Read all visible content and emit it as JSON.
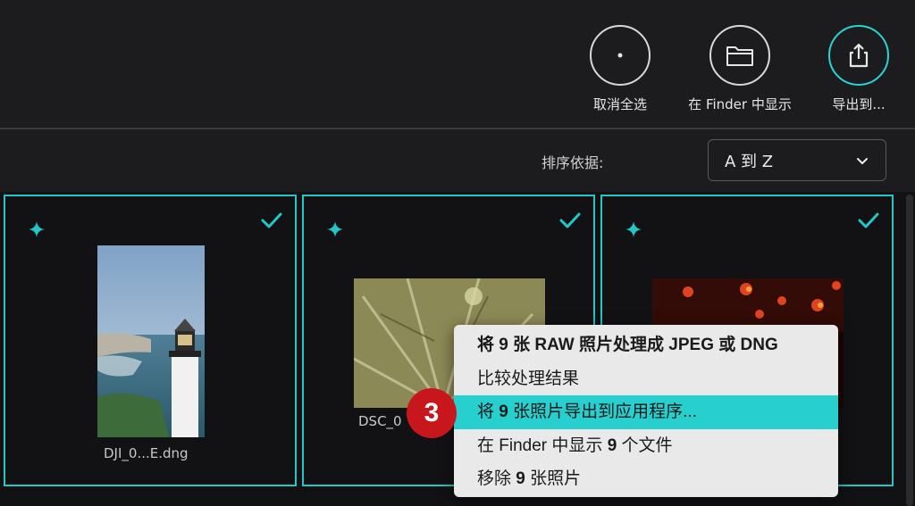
{
  "toolbar": {
    "deselect_label": "取消全选",
    "finder_label": "在 Finder 中显示",
    "export_label": "导出到..."
  },
  "sort": {
    "label": "排序依据:",
    "value": "A 到 Z"
  },
  "cards": [
    {
      "filename": "DJI_0...E.dng",
      "selected": true,
      "sparkle": true
    },
    {
      "filename": "DSC_0",
      "selected": true,
      "sparkle": true
    },
    {
      "filename": "",
      "selected": true,
      "sparkle": true
    }
  ],
  "context_menu": {
    "items": [
      {
        "pre": "将 ",
        "n": "9",
        "post": " 张 RAW 照片处理成 JPEG 或 DNG"
      },
      {
        "pre": "比较处理结果",
        "n": "",
        "post": ""
      },
      {
        "pre": "将 ",
        "n": "9",
        "post": " 张照片导出到应用程序..."
      },
      {
        "pre": "在 Finder 中显示 ",
        "n": "9",
        "post": " 个文件"
      },
      {
        "pre": "移除 ",
        "n": "9",
        "post": " 张照片"
      }
    ],
    "highlighted_index": 2
  },
  "step_badge": "3",
  "colors": {
    "accent": "#22c7c7",
    "highlight": "#27d0cf",
    "badge": "#c8161d",
    "background": "#1c1c1e"
  }
}
